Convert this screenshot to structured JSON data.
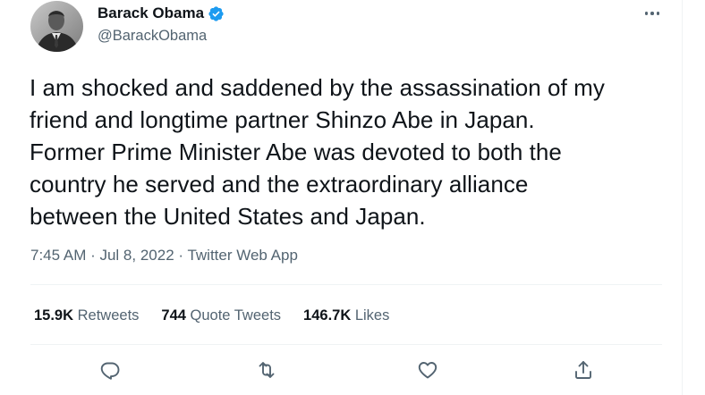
{
  "author": {
    "name": "Barack Obama",
    "handle": "@BarackObama",
    "verified": true,
    "verified_color": "#1d9bf0"
  },
  "tweet": {
    "text": "I am shocked and saddened by the assassination of my\nfriend and longtime partner Shinzo Abe in Japan.\nFormer Prime Minister Abe was devoted to both the\ncountry he served and the extraordinary alliance\nbetween the United States and Japan.",
    "meta": "7:45 AM · Jul 8, 2022 · Twitter Web App"
  },
  "stats": [
    {
      "count": "15.9K",
      "label": "Retweets"
    },
    {
      "count": "744",
      "label": "Quote Tweets"
    },
    {
      "count": "146.7K",
      "label": "Likes"
    }
  ],
  "icons": {
    "more": "more-horizontal-icon",
    "reply": "reply-icon",
    "retweet": "retweet-icon",
    "like": "heart-icon",
    "share": "share-icon"
  },
  "colors": {
    "text": "#0f1419",
    "secondary": "#536471",
    "divider": "#eff3f4"
  }
}
